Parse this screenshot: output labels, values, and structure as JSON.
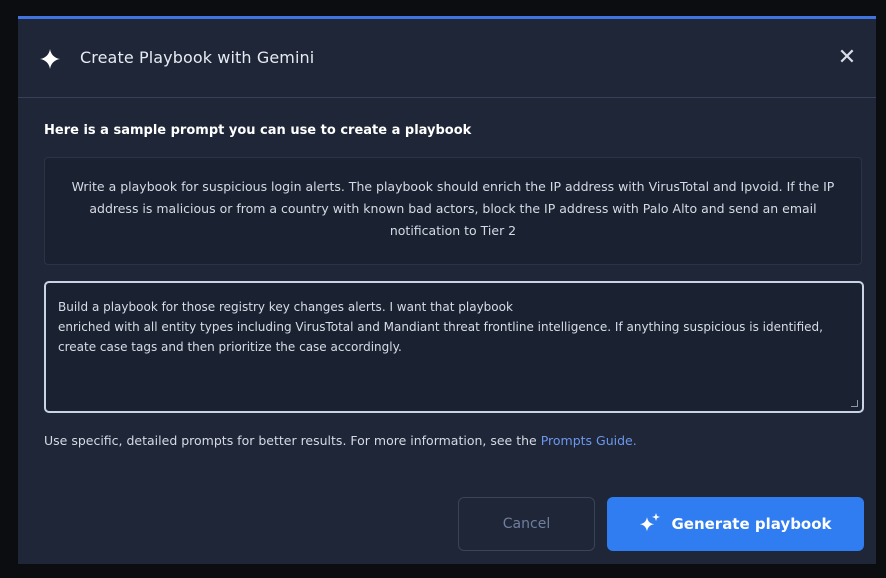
{
  "dialog": {
    "title": "Create Playbook with Gemini",
    "title_icon": "sparkle-icon",
    "close_icon": "close-icon",
    "close_glyph": "✕"
  },
  "sample": {
    "heading": "Here is a sample prompt you can use to create a playbook",
    "text": "Write a playbook for suspicious login alerts. The playbook should enrich the IP address with VirusTotal and Ipvoid. If the IP address is malicious or from a country with known bad actors, block the IP address with Palo Alto and send an email notification to Tier 2"
  },
  "prompt_input": {
    "value_line1": "Build a playbook for those registry key changes alerts. I want that playbook",
    "value_line2": "enriched with all entity types including VirusTotal and Mandiant threat frontline intelligence. If anything suspicious is identified, create case tags and then prioritize the case accordingly."
  },
  "help": {
    "text": "Use specific, detailed prompts for better results. For more information, see the ",
    "link_label": "Prompts Guide",
    "suffix": "."
  },
  "actions": {
    "cancel_label": "Cancel",
    "generate_label": "Generate playbook",
    "generate_icon": "sparkle-plus-icon"
  },
  "colors": {
    "background": "#1e2637",
    "accent": "#2f7df0",
    "link": "#6d97ee"
  }
}
